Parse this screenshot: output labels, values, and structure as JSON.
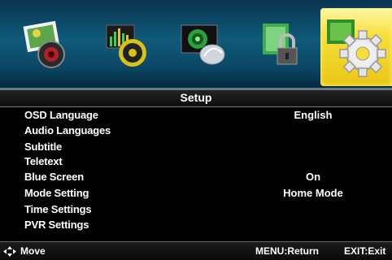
{
  "screen_title": "Setup",
  "icons": [
    {
      "name": "picture-icon",
      "selected": false
    },
    {
      "name": "sound-icon",
      "selected": false
    },
    {
      "name": "channel-icon",
      "selected": false
    },
    {
      "name": "lock-icon",
      "selected": false
    },
    {
      "name": "setup-gear-icon",
      "selected": true
    }
  ],
  "menu": {
    "items": [
      {
        "label": "OSD Language",
        "value": "English"
      },
      {
        "label": "Audio Languages",
        "value": ""
      },
      {
        "label": "Subtitle",
        "value": ""
      },
      {
        "label": "Teletext",
        "value": ""
      },
      {
        "label": "Blue Screen",
        "value": "On"
      },
      {
        "label": "Mode Setting",
        "value": "Home Mode"
      },
      {
        "label": "Time Settings",
        "value": ""
      },
      {
        "label": "PVR Settings",
        "value": ""
      }
    ]
  },
  "footer": {
    "move": "Move",
    "menu_return": "MENU:Return",
    "exit": "EXIT:Exit"
  },
  "colors": {
    "icon_bar_bg": "#0f5a7a",
    "selected_tab": "#f7df3a",
    "text": "#ffffff"
  }
}
